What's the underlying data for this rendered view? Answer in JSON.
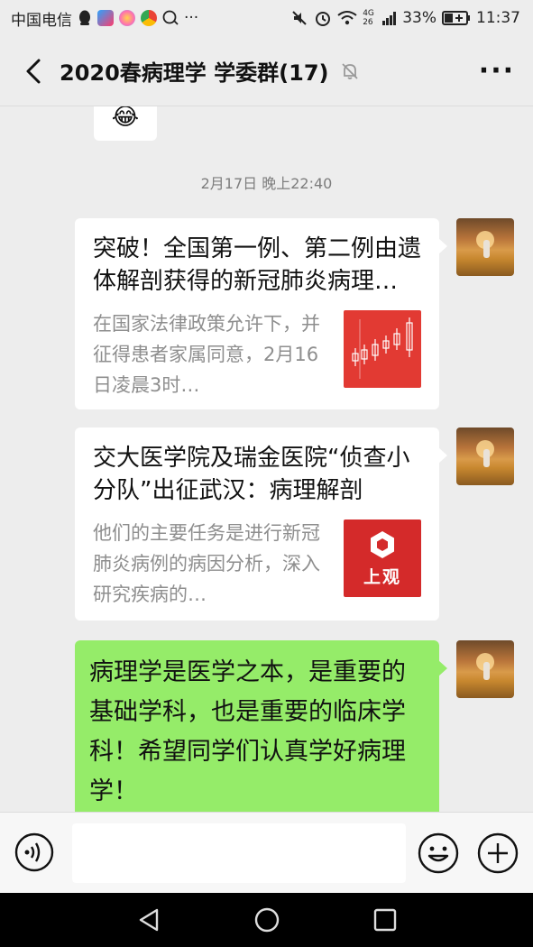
{
  "status_bar": {
    "carrier": "中国电信",
    "signal": "4G 26",
    "battery": "33%",
    "time": "11:37",
    "more": "···"
  },
  "header": {
    "title": "2020春病理学 学委群(17)",
    "back_icon": "chevron-left-icon",
    "mute_icon": "bell-off-icon",
    "more_icon": "more-icon",
    "more_label": "···"
  },
  "chat": {
    "timestamp": "2月17日 晚上22:40",
    "top_emoji": "😂",
    "messages": [
      {
        "type": "link-card",
        "title": "突破！全国第一例、第二例由遗体解剖获得的新冠肺炎病理报告出炉",
        "desc": "在国家法律政策允许下，并征得患者家属同意，2月16日凌晨3时…",
        "thumb": "stock-chart-thumbnail"
      },
      {
        "type": "link-card",
        "title": "交大医学院及瑞金医院“侦查小分队”出征武汉：病理解剖",
        "desc": "他们的主要任务是进行新冠肺炎病例的病因分析，深入研究疾病的…",
        "thumb": "shangguan-logo",
        "thumb_label": "上观"
      },
      {
        "type": "text",
        "text": "病理学是医学之本，是重要的基础学科，也是重要的临床学科！希望同学们认真学好病理学！"
      }
    ]
  },
  "input_bar": {
    "voice_icon": "voice-icon",
    "emoji_icon": "emoji-icon",
    "plus_icon": "plus-icon"
  },
  "colors": {
    "background": "#ededed",
    "bubble_self": "#95ec69",
    "card": "#ffffff",
    "accent_red": "#d42a2a"
  }
}
